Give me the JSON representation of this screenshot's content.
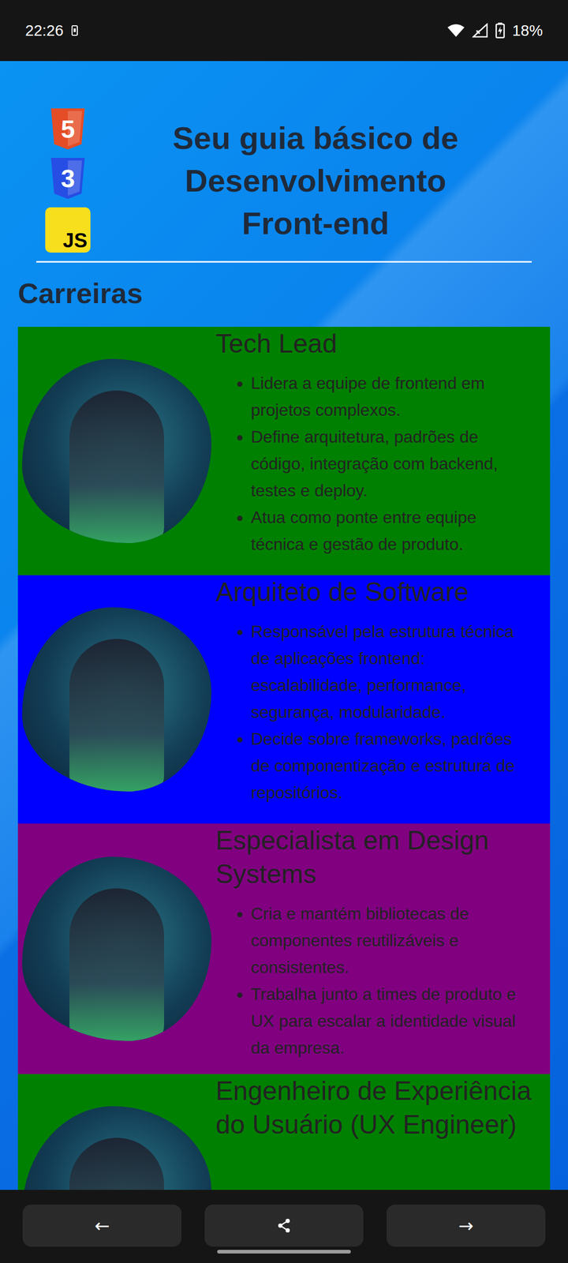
{
  "status_bar": {
    "time": "22:26",
    "battery": "18%"
  },
  "header": {
    "logos": [
      {
        "label": "5",
        "kind": "shield",
        "color": "#e44d26"
      },
      {
        "label": "3",
        "kind": "shield",
        "color": "#264de4"
      },
      {
        "label": "JS",
        "kind": "square",
        "color": "#f7df1e"
      }
    ],
    "title": "Seu guia básico de Desenvolvimento Front-end"
  },
  "section": {
    "title": "Carreiras"
  },
  "careers": [
    {
      "title": "Tech Lead",
      "color": "#008000",
      "points": [
        "Lidera a equipe de frontend em projetos complexos.",
        "Define arquitetura, padrões de código, integração com backend, testes e deploy.",
        "Atua como ponte entre equipe técnica e gestão de produto."
      ]
    },
    {
      "title": "Arquiteto de Software",
      "color": "#0000ff",
      "points": [
        "Responsável pela estrutura técnica de aplicações frontend: escalabilidade, performance, segurança, modularidade.",
        "Decide sobre frameworks, padrões de componentização e estrutura de repositórios."
      ]
    },
    {
      "title": "Especialista em Design Systems",
      "color": "#800080",
      "points": [
        "Cria e mantém bibliotecas de componentes reutilizáveis e consistentes.",
        "Trabalha junto a times de produto e UX para escalar a identidade visual da empresa."
      ]
    },
    {
      "title": "Engenheiro de Experiência do Usuário (UX Engineer)",
      "color": "#008000",
      "points": []
    }
  ],
  "nav": {
    "back": "←",
    "forward": "→"
  }
}
